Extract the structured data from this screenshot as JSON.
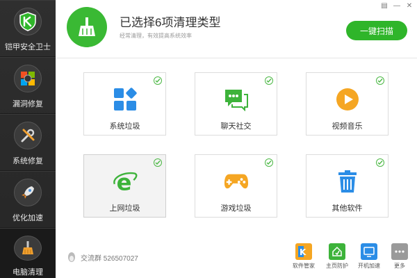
{
  "sidebar": {
    "items": [
      {
        "label": "铠甲安全卫士",
        "icon": "shield-k-icon"
      },
      {
        "label": "漏洞修复",
        "icon": "windows-logo-icon"
      },
      {
        "label": "系统修复",
        "icon": "wrench-screwdriver-icon"
      },
      {
        "label": "优化加速",
        "icon": "rocket-icon"
      },
      {
        "label": "电脑清理",
        "icon": "broom-icon"
      }
    ],
    "active_index": 4
  },
  "window": {
    "controls": [
      "▤",
      "—",
      "✕"
    ]
  },
  "header": {
    "icon": "broom-icon",
    "title": "已选择6项清理类型",
    "subtitle": "经常清理，有效提高系统效率",
    "scan_button": "一键扫描"
  },
  "categories": [
    {
      "label": "系统垃圾",
      "icon": "system-blocks-icon",
      "checked": true
    },
    {
      "label": "聊天社交",
      "icon": "chat-bubbles-icon",
      "checked": true
    },
    {
      "label": "视频音乐",
      "icon": "play-circle-icon",
      "checked": true
    },
    {
      "label": "上网垃圾",
      "icon": "ie-browser-icon",
      "checked": true
    },
    {
      "label": "游戏垃圾",
      "icon": "gamepad-icon",
      "checked": true
    },
    {
      "label": "其他软件",
      "icon": "trash-can-icon",
      "checked": true
    }
  ],
  "footer": {
    "qq_group": "交流群 526507027",
    "tools": [
      {
        "label": "软件管家",
        "icon": "software-manager-icon"
      },
      {
        "label": "主页防护",
        "icon": "homepage-protect-icon"
      },
      {
        "label": "开机加速",
        "icon": "boot-speedup-icon"
      },
      {
        "label": "更多",
        "icon": "more-icon"
      }
    ]
  },
  "colors": {
    "accent_green": "#2fb52a",
    "sidebar_bg": "#2a2a2a"
  }
}
